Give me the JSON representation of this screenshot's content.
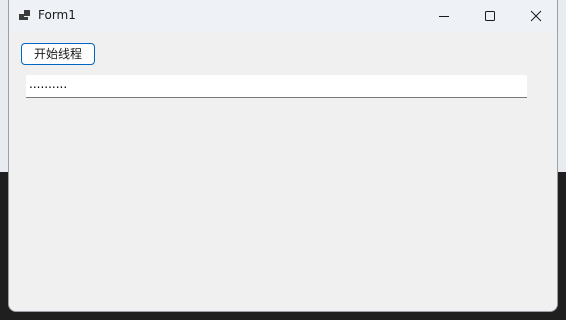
{
  "window": {
    "title": "Form1",
    "icon": "app-window-icon"
  },
  "caption": {
    "minimize_icon": "minimize-icon",
    "maximize_icon": "maximize-icon",
    "close_icon": "close-icon"
  },
  "form": {
    "start_button_label": "开始线程",
    "text_box_value": ".........."
  },
  "colors": {
    "accent": "#0067c0",
    "window_bg": "#f0f0f0",
    "titlebar_bg": "#eef2f7"
  }
}
